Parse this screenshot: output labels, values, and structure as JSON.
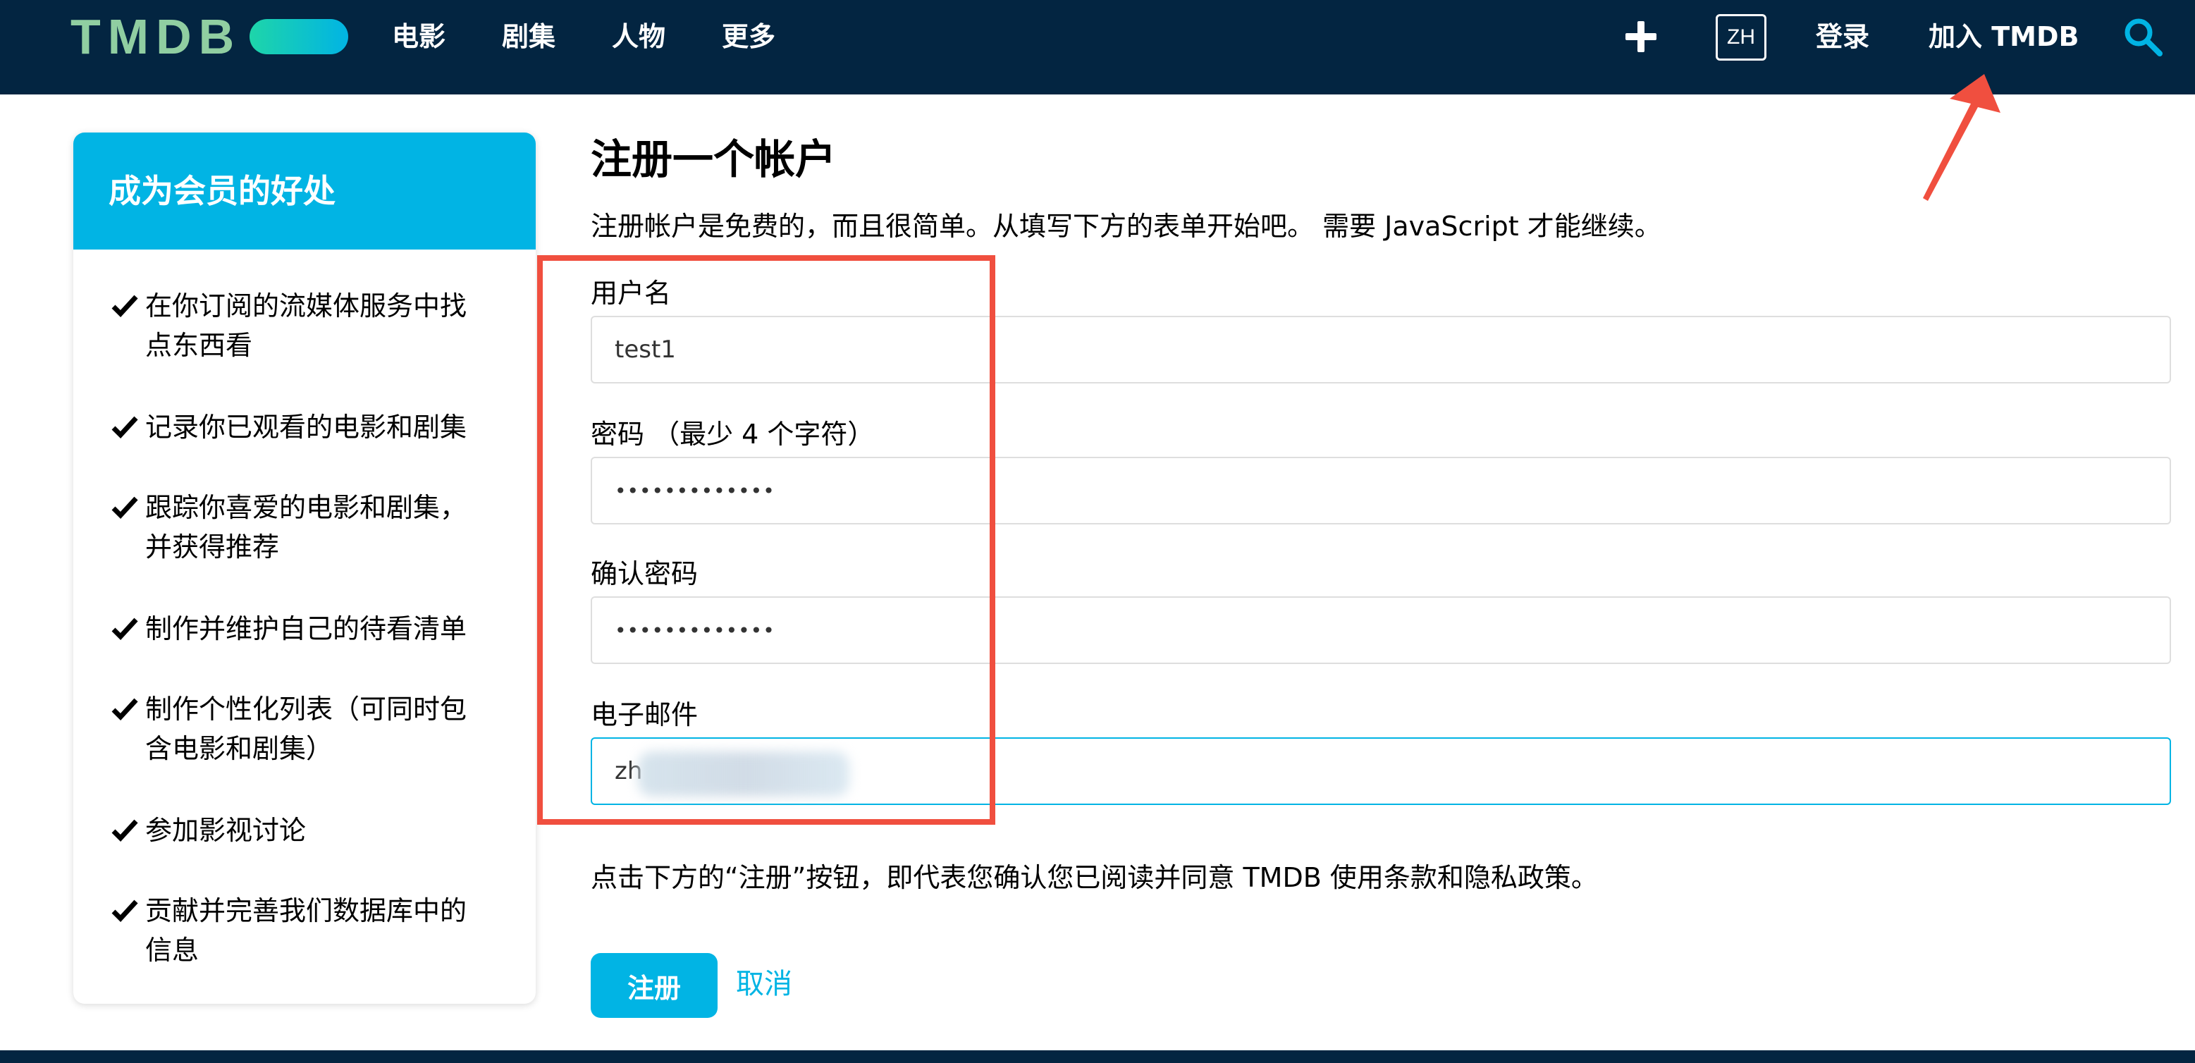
{
  "header": {
    "logo_text": "TMDB",
    "nav": [
      "电影",
      "剧集",
      "人物",
      "更多"
    ],
    "language": "ZH",
    "login": "登录",
    "join": "加入 TMDB"
  },
  "sidebar": {
    "title": "成为会员的好处",
    "perks": [
      [
        "在你订阅的流媒体服务中找",
        "点东西看"
      ],
      [
        "记录你已观看的电影和剧集"
      ],
      [
        "跟踪你喜爱的电影和剧集，",
        "并获得推荐"
      ],
      [
        "制作并维护自己的待看清单"
      ],
      [
        "制作个性化列表（可同时包",
        "含电影和剧集）"
      ],
      [
        "参加影视讨论"
      ],
      [
        "贡献并完善我们数据库中的",
        "信息"
      ]
    ]
  },
  "main": {
    "title": "注册一个帐户",
    "subtitle": "注册帐户是免费的，而且很简单。从填写下方的表单开始吧。 需要 JavaScript 才能继续。",
    "fields": {
      "username": {
        "label": "用户名",
        "value": "test1"
      },
      "password": {
        "label": "密码 （最少 4 个字符）",
        "value": "•••••••••••••"
      },
      "confirm": {
        "label": "确认密码",
        "value": "•••••••••••••"
      },
      "email": {
        "label": "电子邮件",
        "value": "zh"
      }
    },
    "terms": "点击下方的“注册”按钮，即代表您确认您已阅读并同意 TMDB 使用条款和隐私政策。",
    "signup_button": "注册",
    "cancel": "取消"
  },
  "colors": {
    "header_bg": "#032541",
    "accent": "#01b4e4",
    "annotation": "#f04f3f"
  },
  "icons": [
    "plus-icon",
    "search-icon",
    "check-icon",
    "annotation-arrow-icon"
  ]
}
